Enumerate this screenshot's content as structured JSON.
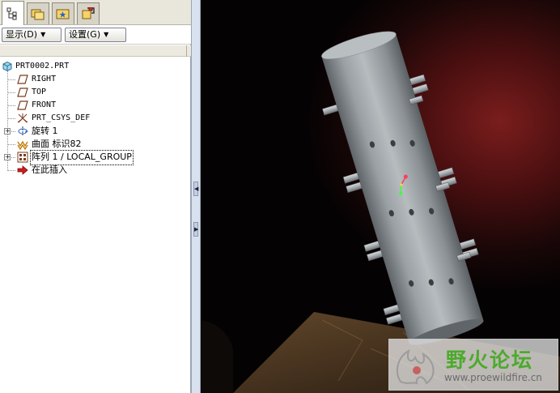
{
  "toolbar": {
    "show_label": "显示(D)",
    "settings_label": "设置(G)"
  },
  "model_tree": {
    "items": [
      {
        "label": "PRT0002.PRT",
        "icon": "part-icon"
      },
      {
        "label": "RIGHT",
        "icon": "datum-plane-icon"
      },
      {
        "label": "TOP",
        "icon": "datum-plane-icon"
      },
      {
        "label": "FRONT",
        "icon": "datum-plane-icon"
      },
      {
        "label": "PRT_CSYS_DEF",
        "icon": "coordinate-system-icon"
      },
      {
        "label": "旋转 1",
        "icon": "revolve-icon"
      },
      {
        "label": "曲面 标识82",
        "icon": "surface-icon"
      },
      {
        "label": "阵列 1 / LOCAL_GROUP",
        "icon": "pattern-icon"
      },
      {
        "label": "在此插入",
        "icon": "insert-here-arrow-icon"
      }
    ]
  },
  "watermark": {
    "title": "野火论坛",
    "url": "www.proewildfire.cn"
  },
  "colors": {
    "background_glow": "#7a1d1d",
    "background_dark": "#050203",
    "model_gray": "#8e9499",
    "watermark_green": "#4caa2c"
  }
}
